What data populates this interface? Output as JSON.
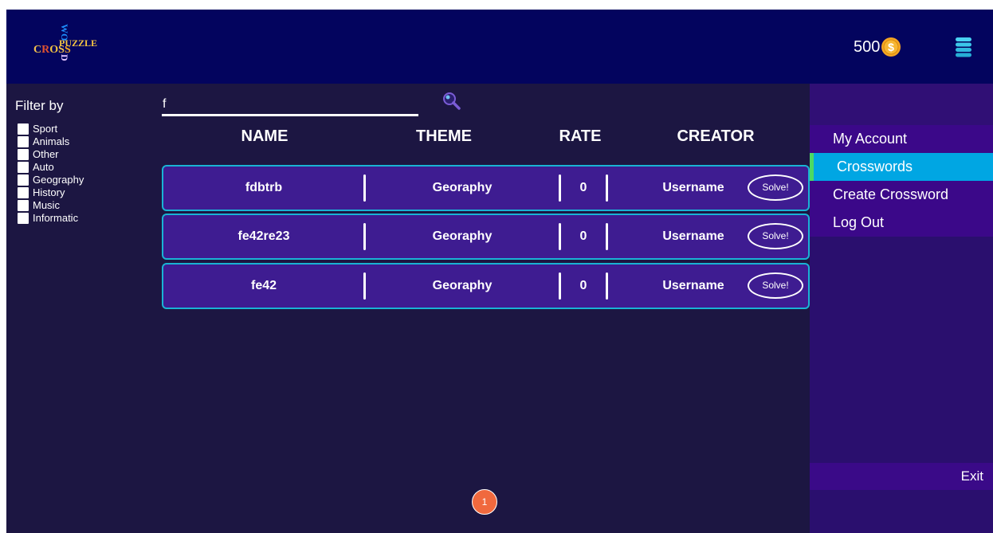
{
  "header": {
    "logo_text": [
      "CROSS",
      "WORD",
      "PUZZLE"
    ],
    "coins": "500",
    "coin_symbol": "$"
  },
  "filter": {
    "title": "Filter by",
    "options": [
      "Sport",
      "Animals",
      "Other",
      "Auto",
      "Geography",
      "History",
      "Music",
      "Informatic"
    ]
  },
  "search": {
    "value": "f"
  },
  "table": {
    "headers": [
      "NAME",
      "THEME",
      "RATE",
      "CREATOR"
    ],
    "rows": [
      {
        "name": "fdbtrb",
        "theme": "Georaphy",
        "rate": "0",
        "creator": "Username",
        "action": "Solve!"
      },
      {
        "name": "fe42re23",
        "theme": "Georaphy",
        "rate": "0",
        "creator": "Username",
        "action": "Solve!"
      },
      {
        "name": "fe42",
        "theme": "Georaphy",
        "rate": "0",
        "creator": "Username",
        "action": "Solve!"
      }
    ]
  },
  "pagination": {
    "current": "1"
  },
  "sidebar": {
    "items": [
      "My Account",
      "Crosswords",
      "Create Crossword",
      "Log Out"
    ],
    "active": "Crosswords",
    "exit": "Exit"
  },
  "colors": {
    "background": "#1c1642",
    "topbar": "#03045e",
    "row_fill": "#3e1c91",
    "row_border": "#19b3d4",
    "active_menu": "#00a6e3",
    "active_marker": "#4cd964",
    "page_button": "#f0693e",
    "coin": "#f5a623"
  },
  "icons": {
    "coin": "coin-icon",
    "menu": "menu-icon",
    "search": "search-icon",
    "logo": "crossword-logo"
  }
}
